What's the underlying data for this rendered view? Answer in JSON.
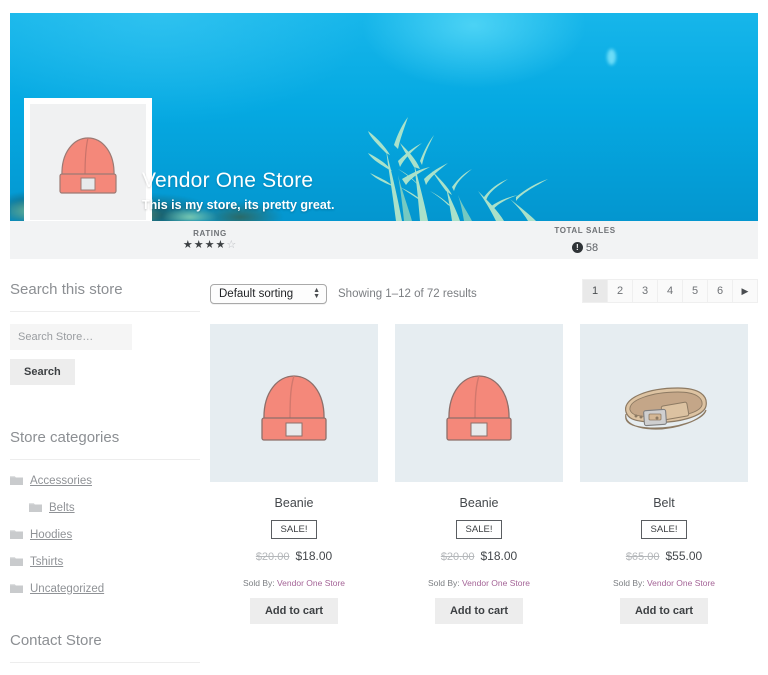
{
  "store": {
    "title": "Vendor One Store",
    "description": "This is my store, its pretty great.",
    "logo_icon": "beanie-image",
    "banner_icon": "underwater-coral-photo"
  },
  "stats": {
    "rating_label": "RATING",
    "rating_stars_filled": 4,
    "rating_stars_total": 5,
    "rating_display": "★★★★☆",
    "sales_label": "TOTAL SALES",
    "sales_badge_glyph": "!",
    "sales_value": "58"
  },
  "sidebar": {
    "search_widget_title": "Search this store",
    "search_placeholder": "Search Store…",
    "search_value": "",
    "search_button_label": "Search",
    "categories_title": "Store categories",
    "categories": [
      {
        "label": "Accessories",
        "child": false,
        "icon": "folder-icon"
      },
      {
        "label": "Belts",
        "child": true,
        "icon": "folder-icon"
      },
      {
        "label": "Hoodies",
        "child": false,
        "icon": "folder-icon"
      },
      {
        "label": "Tshirts",
        "child": false,
        "icon": "folder-icon"
      },
      {
        "label": "Uncategorized",
        "child": false,
        "icon": "folder-icon"
      }
    ],
    "contact_title": "Contact Store"
  },
  "toolbar": {
    "sorting_selected": "Default sorting",
    "sorting_options": [
      "Default sorting"
    ],
    "result_count": "Showing 1–12 of 72 results",
    "pagination": [
      "1",
      "2",
      "3",
      "4",
      "5",
      "6"
    ],
    "pagination_active": "1",
    "pagination_next_glyph": "▶"
  },
  "products": [
    {
      "title": "Beanie",
      "image_icon": "beanie-image",
      "sale_label": "SALE!",
      "price_old": "$20.00",
      "price_new": "$18.00",
      "sold_by_prefix": "Sold By:",
      "sold_by_vendor": "Vendor One Store",
      "add_to_cart_label": "Add to cart"
    },
    {
      "title": "Beanie",
      "image_icon": "beanie-image",
      "sale_label": "SALE!",
      "price_old": "$20.00",
      "price_new": "$18.00",
      "sold_by_prefix": "Sold By:",
      "sold_by_vendor": "Vendor One Store",
      "add_to_cart_label": "Add to cart"
    },
    {
      "title": "Belt",
      "image_icon": "belt-image",
      "sale_label": "SALE!",
      "price_old": "$65.00",
      "price_new": "$55.00",
      "sold_by_prefix": "Sold By:",
      "sold_by_vendor": "Vendor One Store",
      "add_to_cart_label": "Add to cart"
    }
  ],
  "colors": {
    "banner_blue": "#08ade4",
    "beanie_coral": "#f4887a",
    "belt_tan": "#d9bb97",
    "thumb_background": "#e6edf1",
    "vendor_link": "#a46497",
    "button_grey": "#ededed"
  }
}
